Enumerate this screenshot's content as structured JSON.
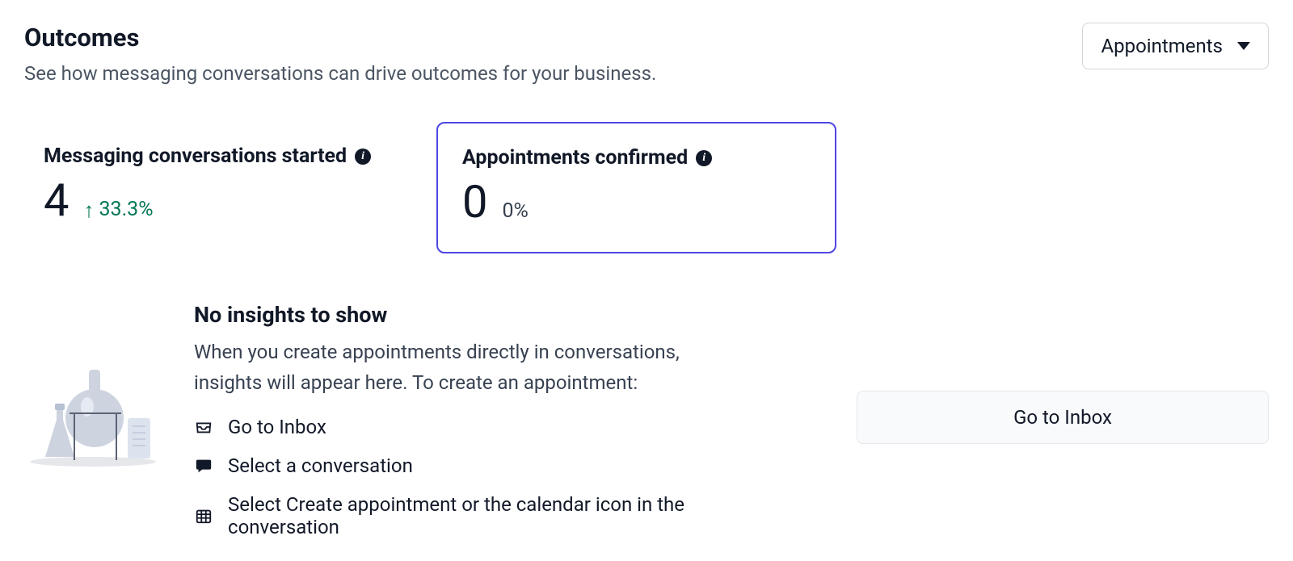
{
  "header": {
    "title": "Outcomes",
    "subtitle": "See how messaging conversations can drive outcomes for your business."
  },
  "dropdown": {
    "selected": "Appointments"
  },
  "metrics": {
    "started": {
      "label": "Messaging conversations started",
      "value": "4",
      "change": "33.3%",
      "direction": "up"
    },
    "confirmed": {
      "label": "Appointments confirmed",
      "value": "0",
      "secondary": "0%"
    }
  },
  "insights": {
    "title": "No insights to show",
    "description": "When you create appointments directly in conversations, insights will appear here. To create an appointment:",
    "steps": [
      "Go to Inbox",
      "Select a conversation",
      "Select Create appointment or the calendar icon in the conversation"
    ]
  },
  "cta": {
    "inbox_button": "Go to Inbox"
  }
}
